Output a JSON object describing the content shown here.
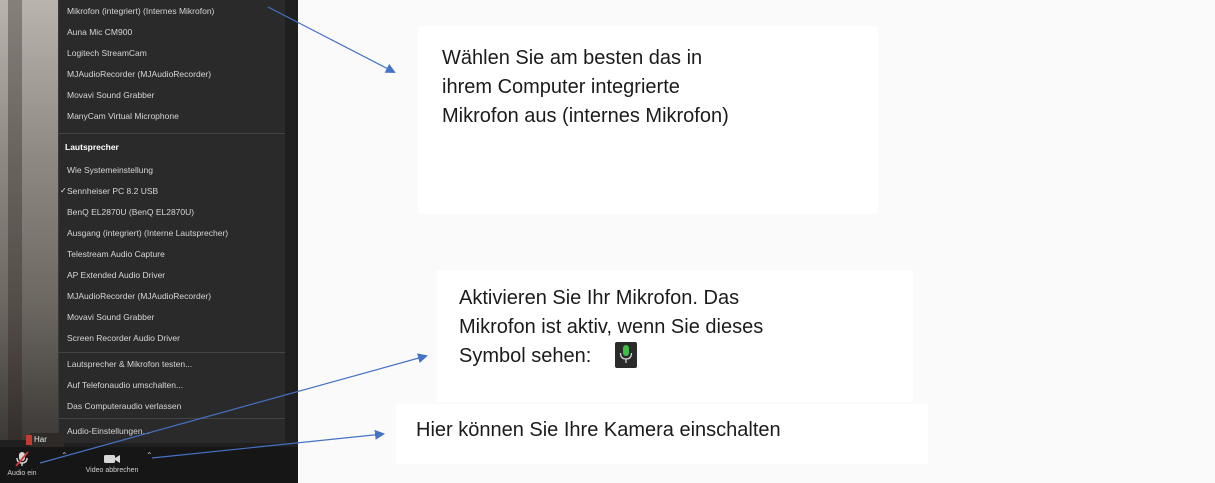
{
  "audio_menu": {
    "microphone_items": [
      "Mikrofon (integriert) (Internes Mikrofon)",
      "Auna Mic CM900",
      "Logitech StreamCam",
      "MJAudioRecorder (MJAudioRecorder)",
      "Movavi Sound Grabber",
      "ManyCam Virtual Microphone"
    ],
    "speaker_header": "Lautsprecher",
    "speaker_items": [
      "Wie Systemeinstellung",
      "Sennheiser PC 8.2 USB",
      "BenQ EL2870U (BenQ EL2870U)",
      "Ausgang (integriert) (Interne Lautsprecher)",
      "Telestream Audio Capture",
      "AP Extended Audio Driver",
      "MJAudioRecorder (MJAudioRecorder)",
      "Movavi Sound Grabber",
      "Screen Recorder Audio Driver"
    ],
    "action_items": [
      "Lautsprecher & Mikrofon testen...",
      "Auf Telefonaudio umschalten...",
      "Das Computeraudio verlassen"
    ],
    "settings_item": "Audio-Einstellungen..."
  },
  "participant_name": "Har",
  "toolbar": {
    "audio_label": "Audio ein",
    "video_label": "Video abbrechen"
  },
  "callouts": {
    "microphone_tip": [
      "Wählen Sie am besten das in",
      "ihrem Computer integrierte",
      "Mikrofon aus (internes Mikrofon)"
    ],
    "activate_tip": [
      "Aktivieren Sie Ihr Mikrofon. Das",
      "Mikrofon ist aktiv, wenn Sie dieses",
      "Symbol sehen:"
    ],
    "camera_tip": "Hier können Sie Ihre Kamera einschalten"
  },
  "icons": {
    "mic_active": "mic-active-icon",
    "mic_muted": "mic-muted-icon",
    "camera": "camera-icon",
    "chevron_up": "chevron-up-icon",
    "checkmark": "checkmark-icon"
  },
  "colors": {
    "arrow": "#4472c4",
    "menu_bg": "#2a2a2a",
    "mic_green": "#3fbf45"
  }
}
